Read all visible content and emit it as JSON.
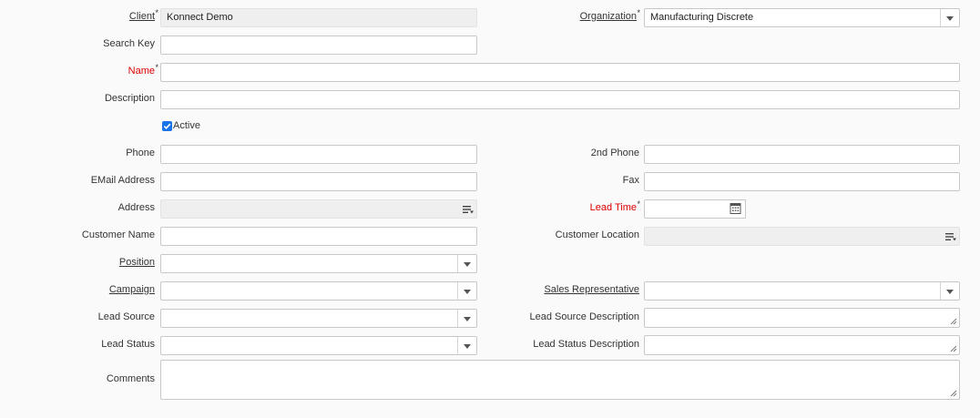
{
  "form": {
    "client": {
      "label": "Client",
      "value": "Konnect Demo"
    },
    "organization": {
      "label": "Organization",
      "value": "Manufacturing Discrete"
    },
    "search_key": {
      "label": "Search Key",
      "value": ""
    },
    "name": {
      "label": "Name",
      "value": ""
    },
    "description": {
      "label": "Description",
      "value": ""
    },
    "active": {
      "label": "Active",
      "checked": true
    },
    "phone": {
      "label": "Phone",
      "value": ""
    },
    "phone2": {
      "label": "2nd Phone",
      "value": ""
    },
    "email": {
      "label": "EMail Address",
      "value": ""
    },
    "fax": {
      "label": "Fax",
      "value": ""
    },
    "address": {
      "label": "Address",
      "value": ""
    },
    "lead_time": {
      "label": "Lead Time",
      "value": ""
    },
    "customer_name": {
      "label": "Customer Name",
      "value": ""
    },
    "customer_location": {
      "label": "Customer Location",
      "value": ""
    },
    "position": {
      "label": "Position",
      "value": ""
    },
    "campaign": {
      "label": "Campaign",
      "value": ""
    },
    "sales_rep": {
      "label": "Sales Representative",
      "value": ""
    },
    "lead_source": {
      "label": "Lead Source",
      "value": ""
    },
    "lead_source_desc": {
      "label": "Lead Source Description",
      "value": ""
    },
    "lead_status": {
      "label": "Lead Status",
      "value": ""
    },
    "lead_status_desc": {
      "label": "Lead Status Description",
      "value": ""
    },
    "comments": {
      "label": "Comments",
      "value": ""
    },
    "mandatory_marker": "*"
  },
  "icons": {
    "dropdown": "chevron-down-icon",
    "location": "list-icon",
    "calendar": "calendar-icon",
    "resize": "resize-grip-icon",
    "checkbox": "checkbox-checked-icon"
  },
  "colors": {
    "mandatory_label": "#dd0000",
    "checkbox": "#1a73e8",
    "readonly_bg": "#efefef"
  }
}
